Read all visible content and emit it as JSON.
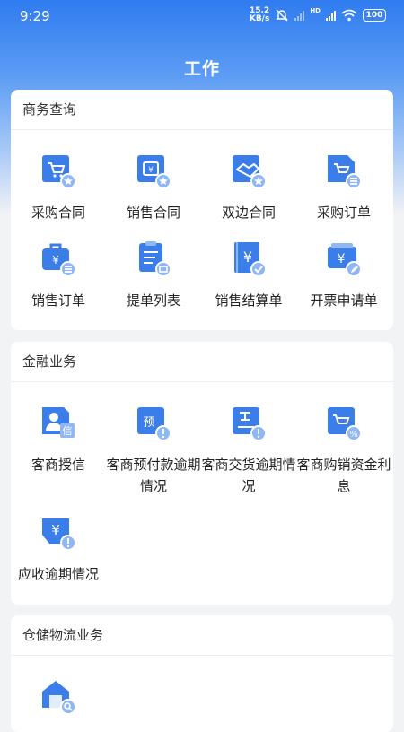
{
  "status": {
    "time": "9:29",
    "net_speed_top": "15.2",
    "net_speed_bottom": "KB/s",
    "battery": "100",
    "hd": "HD"
  },
  "header": {
    "title": "工作"
  },
  "sections": [
    {
      "title": "商务查询",
      "items": [
        {
          "label": "采购合同",
          "icon": "cart-star-icon"
        },
        {
          "label": "销售合同",
          "icon": "yen-bag-star-icon"
        },
        {
          "label": "双边合同",
          "icon": "handshake-star-icon"
        },
        {
          "label": "采购订单",
          "icon": "cart-list-icon"
        },
        {
          "label": "销售订单",
          "icon": "yen-bag-list-icon"
        },
        {
          "label": "提单列表",
          "icon": "document-list-icon"
        },
        {
          "label": "销售结算单",
          "icon": "yen-notebook-check-icon"
        },
        {
          "label": "开票申请单",
          "icon": "yen-ticket-edit-icon"
        }
      ]
    },
    {
      "title": "金融业务",
      "items": [
        {
          "label": "客商授信",
          "icon": "person-credit-icon"
        },
        {
          "label": "客商预付款逾期情况",
          "icon": "prepay-alert-icon"
        },
        {
          "label": "客商交货逾期情况",
          "icon": "delivery-alert-icon"
        },
        {
          "label": "客商购销资金利息",
          "icon": "cart-percent-icon"
        },
        {
          "label": "应收逾期情况",
          "icon": "yen-hand-alert-icon"
        }
      ]
    },
    {
      "title": "仓储物流业务",
      "items": [
        {
          "label": "",
          "icon": "warehouse-search-icon"
        }
      ]
    }
  ],
  "colors": {
    "primary": "#2f7cf0",
    "icon_blue": "#3b7de9",
    "badge_blue": "#8fb6f5"
  }
}
